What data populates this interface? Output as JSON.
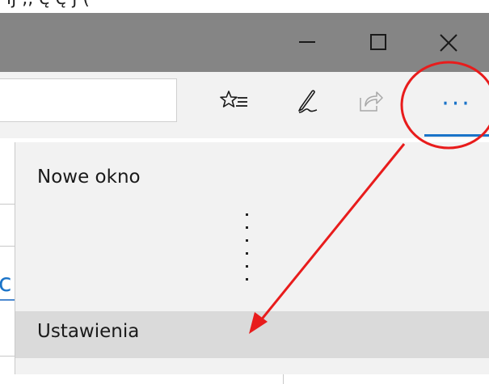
{
  "top_partial_text": "ij  ,,  ę      ę  j  ( ",
  "window_controls": {
    "minimize_icon": "minimize-icon",
    "maximize_icon": "maximize-icon",
    "close_icon": "close-icon"
  },
  "toolbar": {
    "favorites_icon": "favorites-star-list-icon",
    "notes_icon": "pen-notes-icon",
    "share_icon": "share-icon",
    "more_label": "···",
    "accent_color": "#1a73c8"
  },
  "menu": {
    "items": [
      {
        "label": "Nowe okno"
      },
      {
        "label": "Ustawienia",
        "highlighted": true
      }
    ],
    "omitted_marker": "vertical-ellipsis"
  },
  "annotation": {
    "color": "#e81c1c",
    "circle": "red-circle-highlight",
    "arrow": "red-arrow"
  },
  "colors": {
    "titlebar": "#858585",
    "toolbar": "#f2f2f2",
    "menu_background": "#f2f2f2",
    "menu_highlight": "#dadada"
  }
}
